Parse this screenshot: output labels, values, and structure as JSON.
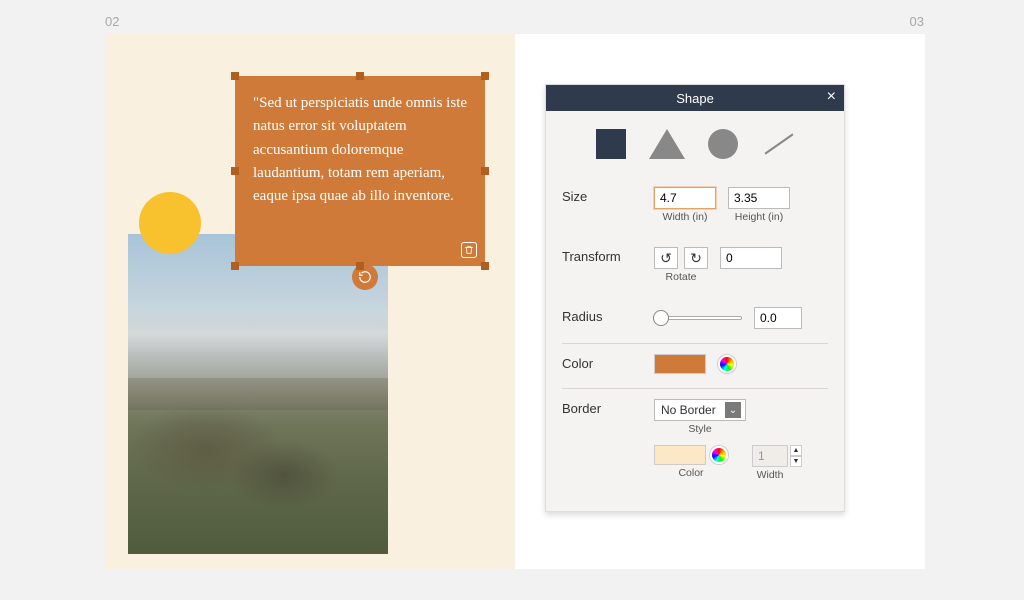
{
  "page_numbers": {
    "left": "02",
    "right": "03"
  },
  "canvas": {
    "quote_text": "\"Sed ut perspiciatis unde omnis iste natus error sit voluptatem accusantium doloremque laudantium, totam rem aperiam, eaque ipsa quae ab illo inventore."
  },
  "inspector": {
    "title": "Shape",
    "shapes": [
      "square",
      "triangle",
      "circle",
      "line"
    ],
    "selected_shape": "square",
    "size": {
      "label": "Size",
      "width": "4.7",
      "width_sub": "Width (in)",
      "height": "3.35",
      "height_sub": "Height (in)"
    },
    "transform": {
      "label": "Transform",
      "rotate_sub": "Rotate",
      "angle": "0"
    },
    "radius": {
      "label": "Radius",
      "value": "0.0"
    },
    "color": {
      "label": "Color",
      "value": "#cf7a38"
    },
    "border": {
      "label": "Border",
      "style_selected": "No Border",
      "style_sub": "Style",
      "color_sub": "Color",
      "color_value": "#fce7c7",
      "width_value": "1",
      "width_sub": "Width"
    }
  }
}
